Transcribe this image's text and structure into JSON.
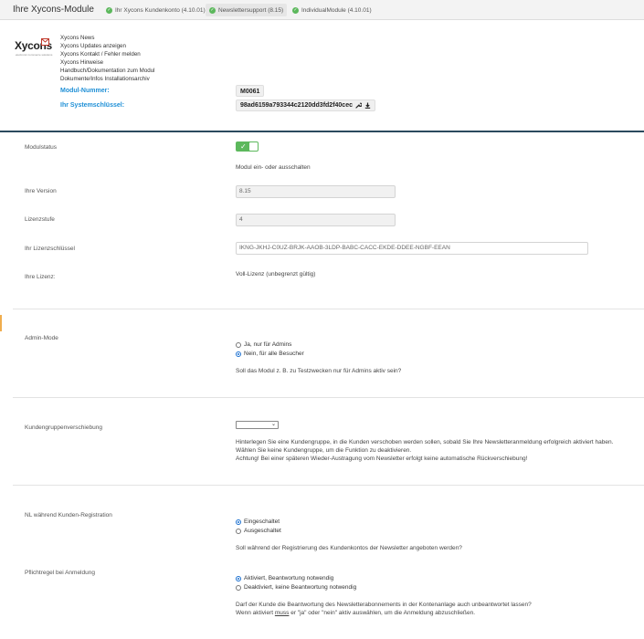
{
  "header": {
    "title": "Ihre Xycons-Module",
    "tabs": [
      {
        "label": "Ihr Xycons Kundenkonto (4.10.01)",
        "active": false
      },
      {
        "label": "Newslettersupport (8.15)",
        "active": true
      },
      {
        "label": "IndividualModule (4.10.01)",
        "active": false
      }
    ]
  },
  "module_header": {
    "logo_text": "Xycons",
    "logo_sub": "electronic commerce solutions",
    "links": [
      "Xycons News",
      "Xycons Updates anzeigen",
      "Xycons Kontakt / Fehler melden",
      "Xycons Hinweise",
      "Handbuch/Dokumentation zum Modul",
      "Dokumente/Infos Installationsarchiv"
    ],
    "module_number_label": "Modul-Nummer:",
    "module_number": "M0061",
    "system_key_label": "Ihr Systemschlüssel:",
    "system_key": "98ad6159a793344c2120dd3fd2f40cec"
  },
  "form": {
    "modulstatus": {
      "label": "Modulstatus",
      "enabled": true,
      "help": "Modul ein- oder ausschalten"
    },
    "version": {
      "label": "Ihre Version",
      "value": "8.15"
    },
    "lizenzstufe": {
      "label": "Lizenzstufe",
      "value": "4"
    },
    "lizenzschluessel": {
      "label": "Ihr Lizenzschlüssel",
      "value": "IKNG-JKHJ-C0UZ-BRJK-AAOB-3LDP-BABC-CACC-EKDE-DDEE-NGBF-EEAN"
    },
    "lizenz": {
      "label": "Ihre Lizenz:",
      "value": "Voll-Lizenz (unbegrenzt gültig)"
    },
    "admin_mode": {
      "label": "Admin-Mode",
      "options": [
        {
          "label": "Ja, nur für Admins",
          "checked": false
        },
        {
          "label": "Nein, für alle Besucher",
          "checked": true
        }
      ],
      "help": "Soll das Modul z. B. zu Testzwecken nur für Admins aktiv sein?"
    },
    "kundengruppe": {
      "label": "Kundengruppenverschiebung",
      "selected": "",
      "help1": "Hinterlegen Sie eine Kundengruppe, in die Kunden verschoben werden sollen, sobald Sie Ihre Newsletteranmeldung erfolgreich aktiviert haben.",
      "help2": "Wählen Sie keine Kundengruppe, um die Funktion zu deaktivieren.",
      "help3": "Achtung! Bei einer späteren Wieder-Austragung vom Newsletter erfolgt keine automatische Rückverschiebung!"
    },
    "nl_registration": {
      "label": "NL während Kunden-Registration",
      "options": [
        {
          "label": "Eingeschaltet",
          "checked": true
        },
        {
          "label": "Ausgeschaltet",
          "checked": false
        }
      ],
      "help": "Soll während der Registrierung des Kundenkontos der Newsletter angeboten werden?"
    },
    "pflichtregel": {
      "label": "Pflichtregel bei Anmeldung",
      "options": [
        {
          "label": "Aktiviert, Beantwortung notwendig",
          "checked": true
        },
        {
          "label": "Deaktiviert, keine Beantwortung notwendig",
          "checked": false
        }
      ],
      "help1": "Darf der Kunde die Beantwortung des Newsletterabonnements in der Kontenanlage auch unbeantwortet lassen?",
      "help2_pre": "Wenn aktiviert ",
      "help2_em": "muss",
      "help2_post": " er \"ja\" oder \"nein\" aktiv auswählen, um die Anmeldung abzuschließen."
    }
  },
  "colors": {
    "accent_blue": "#1e8fd6",
    "toggle_green": "#5cb85c",
    "divider_dark": "#2b4a5e",
    "marker_orange": "#f0ad4e"
  }
}
